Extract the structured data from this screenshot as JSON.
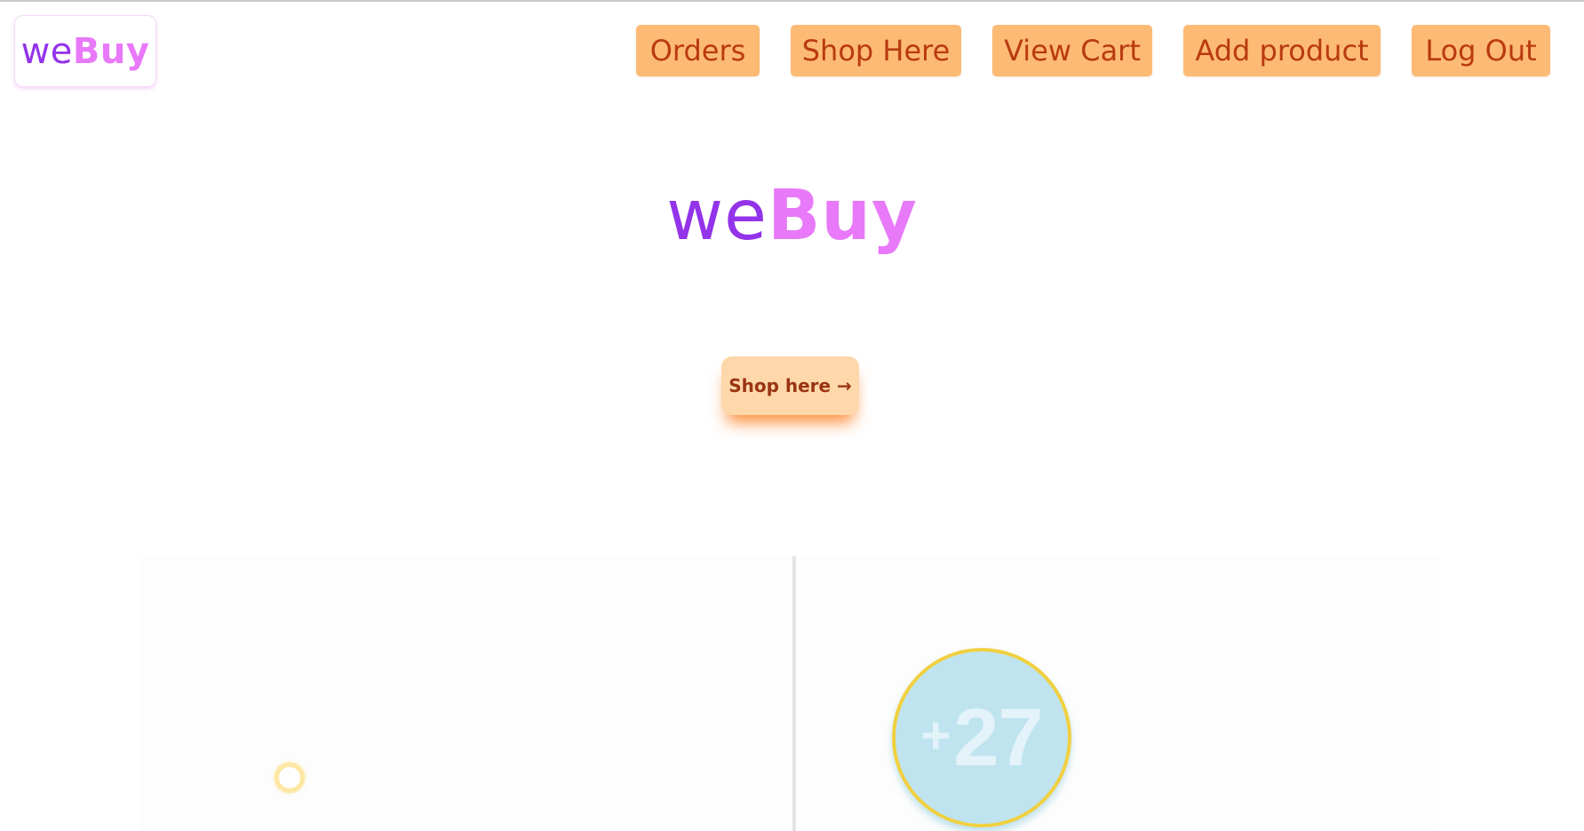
{
  "brand": {
    "prefix": "we",
    "suffix": "Buy"
  },
  "nav": {
    "orders": "Orders",
    "shop_here": "Shop Here",
    "view_cart": "View Cart",
    "add_product": "Add product",
    "log_out": "Log Out"
  },
  "hero": {
    "title_prefix": "we",
    "title_suffix": "Buy",
    "cta_label": "Shop here →"
  },
  "badge": {
    "plus": "+",
    "count": "27"
  },
  "colors": {
    "brand_purple": "#9333ea",
    "brand_pink": "#e879f9",
    "nav_bg": "#fdba74",
    "nav_text": "#b93a10",
    "cta_bg": "#fed7aa",
    "badge_bg": "#bfe4ef",
    "badge_ring": "#f0d040"
  }
}
